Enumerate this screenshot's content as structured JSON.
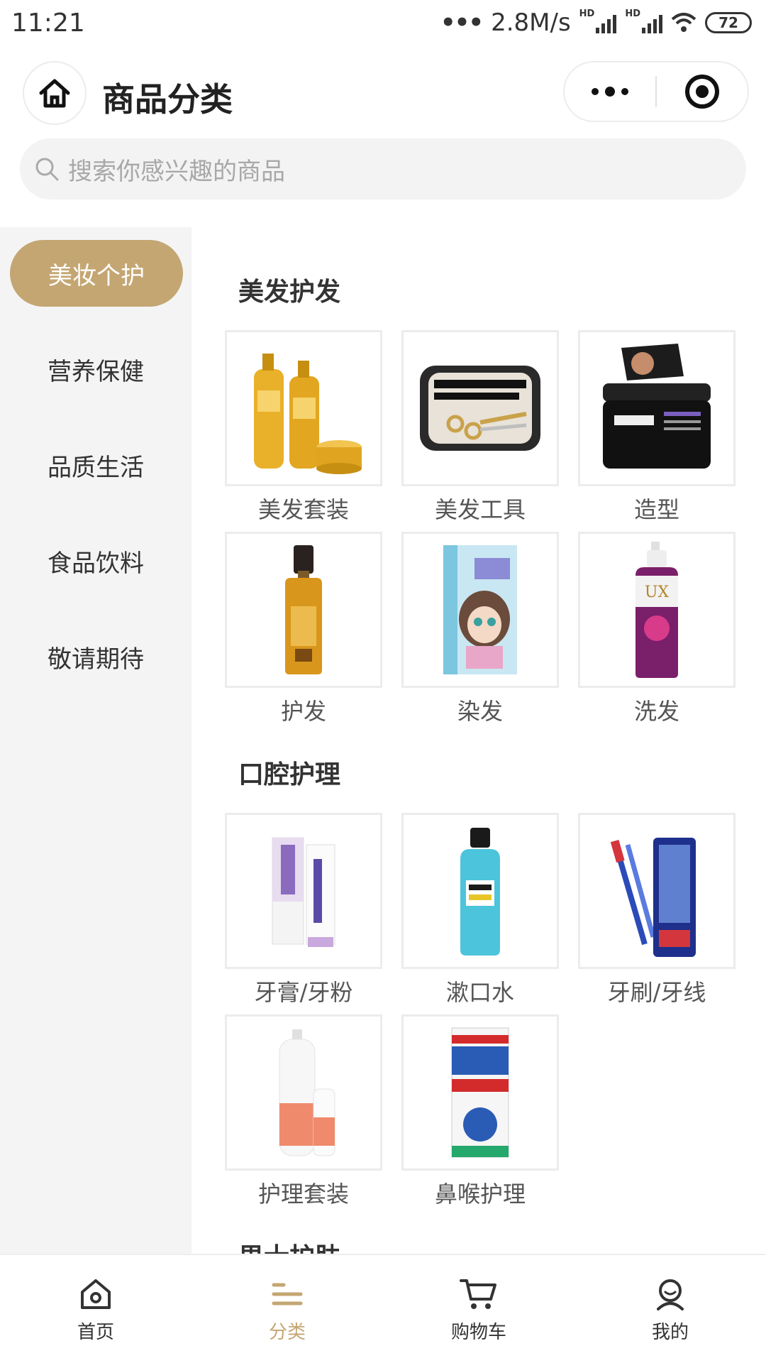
{
  "status_bar": {
    "time": "11:21",
    "net_speed": "2.8M/s",
    "hd1": "HD",
    "hd2": "HD",
    "battery": "72"
  },
  "header": {
    "title": "商品分类",
    "home_icon": "home-icon",
    "more_icon": "more-dots-icon",
    "close_icon": "target-close-icon"
  },
  "search": {
    "placeholder": "搜索你感兴趣的商品",
    "icon": "search-icon"
  },
  "sidebar": {
    "items": [
      {
        "label": "美妆个护",
        "active": true
      },
      {
        "label": "营养保健",
        "active": false
      },
      {
        "label": "品质生活",
        "active": false
      },
      {
        "label": "食品饮料",
        "active": false
      },
      {
        "label": "敬请期待",
        "active": false
      }
    ]
  },
  "sections": [
    {
      "title": "美发护发",
      "items": [
        {
          "label": "美发套装",
          "image": "shampoo-bottles-set"
        },
        {
          "label": "美发工具",
          "image": "hair-scissors-kit"
        },
        {
          "label": "造型",
          "image": "hair-wax-jar"
        },
        {
          "label": "护发",
          "image": "hair-oil-bottle"
        },
        {
          "label": "染发",
          "image": "hair-dye-box"
        },
        {
          "label": "洗发",
          "image": "shampoo-pump-bottle"
        }
      ]
    },
    {
      "title": "口腔护理",
      "items": [
        {
          "label": "牙膏/牙粉",
          "image": "toothpaste-tubes"
        },
        {
          "label": "漱口水",
          "image": "mouthwash-bottle"
        },
        {
          "label": "牙刷/牙线",
          "image": "toothbrush-pack"
        },
        {
          "label": "护理套装",
          "image": "spray-care-set"
        },
        {
          "label": "鼻喉护理",
          "image": "throat-spray-box"
        }
      ]
    },
    {
      "title": "男士护肤",
      "items": []
    }
  ],
  "tabbar": {
    "items": [
      {
        "label": "首页",
        "icon": "home-tab-icon",
        "active": false
      },
      {
        "label": "分类",
        "icon": "category-list-icon",
        "active": true
      },
      {
        "label": "购物车",
        "icon": "shopping-cart-icon",
        "active": false
      },
      {
        "label": "我的",
        "icon": "user-profile-icon",
        "active": false
      }
    ]
  },
  "colors": {
    "accent": "#c4a673",
    "sidebar_bg": "#f4f4f4",
    "search_bg": "#f3f3f3"
  }
}
